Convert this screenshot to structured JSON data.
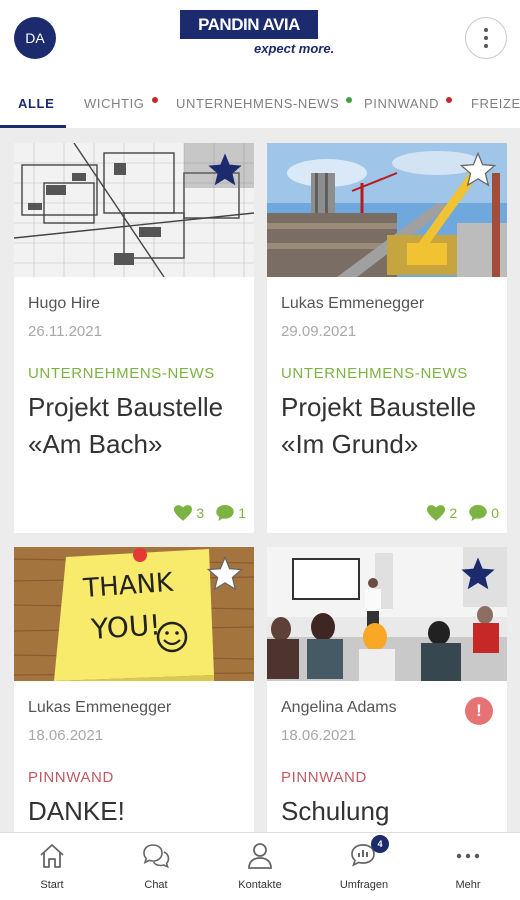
{
  "header": {
    "avatar_initials": "DA",
    "logo_text": "PANDIN AVIA",
    "logo_tagline": "expect more.",
    "menu_icon": "more-vertical-icon"
  },
  "tabs": [
    {
      "label": "ALLE",
      "active": true
    },
    {
      "label": "WICHTIG",
      "dot_color": "#c62828"
    },
    {
      "label": "UNTERNEHMENS-NEWS",
      "dot_color": "#43a047"
    },
    {
      "label": "PINNWAND",
      "dot_color": "#c62828"
    },
    {
      "label": "FREIZEIT"
    }
  ],
  "colors": {
    "brand": "#1c2a6e",
    "news_green": "#7cb342",
    "pinnwand_red": "#c05a62",
    "alert": "#e57373"
  },
  "posts": [
    {
      "author": "Hugo Hire",
      "date": "26.11.2021",
      "category": "UNTERNEHMENS-NEWS",
      "title": "Projekt Baustelle «Am Bach»",
      "likes": "3",
      "comments": "1",
      "favorite": true,
      "image": "blueprint"
    },
    {
      "author": "Lukas Emmenegger",
      "date": "29.09.2021",
      "category": "UNTERNEHMENS-NEWS",
      "title": "Projekt Baustelle «Im Grund»",
      "likes": "2",
      "comments": "0",
      "favorite": false,
      "image": "construction-site"
    },
    {
      "author": "Lukas Emmenegger",
      "date": "18.06.2021",
      "category": "PINNWAND",
      "title": "DANKE!",
      "favorite": false,
      "image": "thank-you-note",
      "note_text_1": "THANK",
      "note_text_2": "YOU!"
    },
    {
      "author": "Angelina Adams",
      "date": "18.06.2021",
      "category": "PINNWAND",
      "title": "Schulung",
      "favorite": true,
      "important": true,
      "alert_mark": "!",
      "image": "training-room"
    }
  ],
  "bottom_nav": [
    {
      "label": "Start",
      "icon": "home-icon"
    },
    {
      "label": "Chat",
      "icon": "chat-icon"
    },
    {
      "label": "Kontakte",
      "icon": "person-icon"
    },
    {
      "label": "Umfragen",
      "icon": "poll-chat-icon",
      "badge": "4"
    },
    {
      "label": "Mehr",
      "icon": "more-horizontal-icon"
    }
  ]
}
